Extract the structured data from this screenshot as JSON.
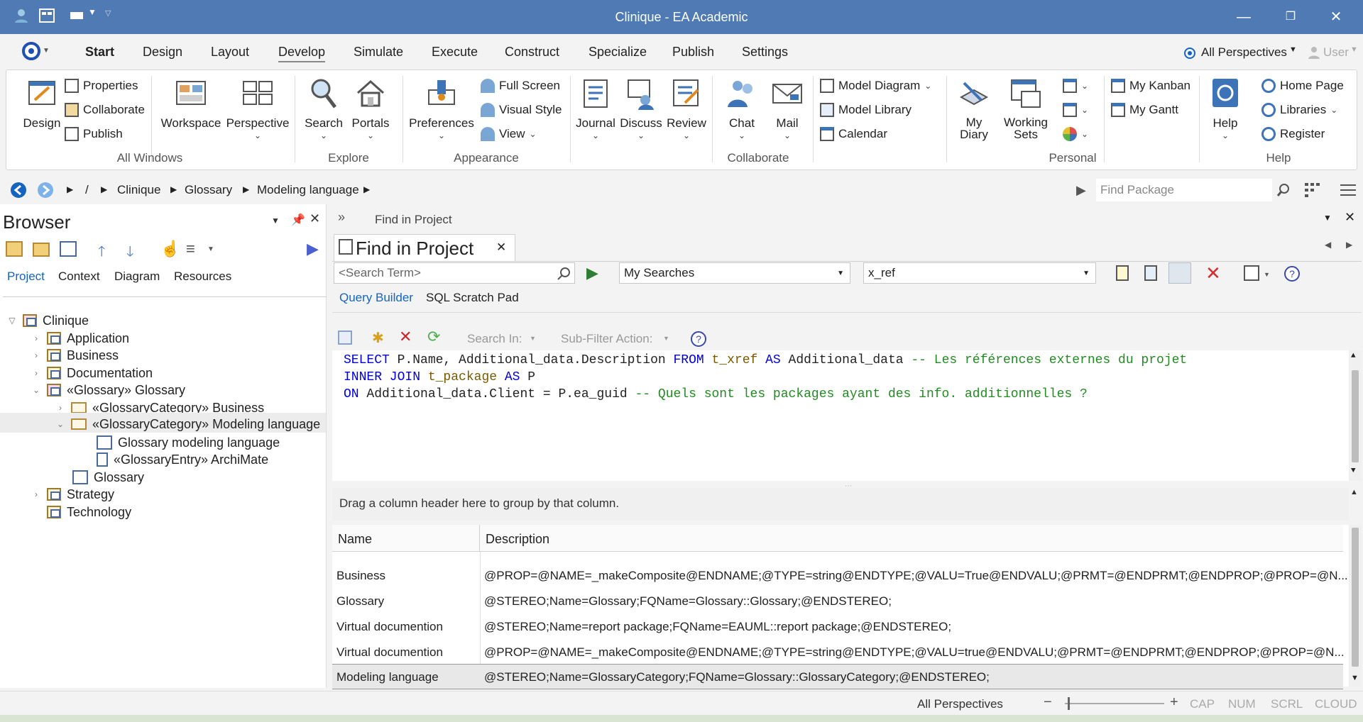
{
  "app": {
    "title": "Clinique - EA Academic"
  },
  "ribbon_tabs": [
    "Start",
    "Design",
    "Layout",
    "Develop",
    "Simulate",
    "Execute",
    "Construct",
    "Specialize",
    "Publish",
    "Settings"
  ],
  "perspectives_label": "All Perspectives",
  "user_label": "User",
  "groups": {
    "all_windows": {
      "label": "All Windows",
      "design": "Design",
      "properties": "Properties",
      "collaborate": "Collaborate",
      "publish": "Publish",
      "workspace": "Workspace",
      "perspective": "Perspective"
    },
    "explore": {
      "label": "Explore",
      "search": "Search",
      "portals": "Portals"
    },
    "appearance": {
      "label": "Appearance",
      "preferences": "Preferences",
      "full_screen": "Full Screen",
      "visual_style": "Visual Style",
      "view": "View"
    },
    "collaborate": {
      "label": "Collaborate",
      "journal": "Journal",
      "discuss": "Discuss",
      "review": "Review",
      "chat": "Chat",
      "mail": "Mail",
      "model_diagram": "Model Diagram",
      "model_library": "Model Library",
      "calendar": "Calendar"
    },
    "personal": {
      "label": "Personal",
      "my_diary_1": "My",
      "my_diary_2": "Diary",
      "working_sets_1": "Working",
      "working_sets_2": "Sets",
      "my_kanban": "My Kanban",
      "my_gantt": "My Gantt"
    },
    "help": {
      "label": "Help",
      "help": "Help",
      "home_page": "Home Page",
      "libraries": "Libraries",
      "register": "Register"
    }
  },
  "breadcrumb": {
    "root": "/",
    "items": [
      "Clinique",
      "Glossary",
      "Modeling language"
    ]
  },
  "find_package_placeholder": "Find Package",
  "browser": {
    "title": "Browser",
    "tabs": [
      "Project",
      "Context",
      "Diagram",
      "Resources"
    ],
    "tree": [
      "Clinique",
      "Application",
      "Business",
      "Documentation",
      "«Glossary» Glossary",
      "«GlossaryCategory» Business",
      "«GlossaryCategory» Modeling language",
      "Glossary modeling language",
      "«GlossaryEntry» ArchiMate",
      "Glossary",
      "Strategy",
      "Technology"
    ]
  },
  "find": {
    "header": "Find in Project",
    "tab_title": "Find in Project",
    "search_placeholder": "<Search Term>",
    "my_searches": "My Searches",
    "search_name": "x_ref",
    "subtabs": [
      "Query Builder",
      "SQL Scratch Pad"
    ],
    "search_in": "Search In:",
    "subfilter": "Sub-Filter Action:",
    "sql": {
      "l1_kw1": "SELECT",
      "l1_a": " P.Name, Additional_data.Description ",
      "l1_kw2": "FROM",
      "l1_tb": " t_xref ",
      "l1_kw3": "AS",
      "l1_b": " Additional_data ",
      "l1_cm": "-- Les références externes du projet",
      "l2_kw1": "INNER JOIN",
      "l2_tb": " t_package ",
      "l2_kw2": "AS",
      "l2_a": " P",
      "l3_kw1": "ON",
      "l3_a": " Additional_data.Client = P.ea_guid ",
      "l3_cm": "-- Quels sont les packages ayant des info. additionnelles ?"
    },
    "group_hint": "Drag a column header here to group by that column.",
    "columns": [
      "Name",
      "Description"
    ],
    "rows": [
      {
        "name": "Business",
        "desc": "@PROP=@NAME=_makeComposite@ENDNAME;@TYPE=string@ENDTYPE;@VALU=True@ENDVALU;@PRMT=@ENDPRMT;@ENDPROP;@PROP=@N..."
      },
      {
        "name": "Glossary",
        "desc": "@STEREO;Name=Glossary;FQName=Glossary::Glossary;@ENDSTEREO;"
      },
      {
        "name": "Virtual documention",
        "desc": "@STEREO;Name=report package;FQName=EAUML::report package;@ENDSTEREO;"
      },
      {
        "name": "Virtual documention",
        "desc": "@PROP=@NAME=_makeComposite@ENDNAME;@TYPE=string@ENDTYPE;@VALU=true@ENDVALU;@PRMT=@ENDPRMT;@ENDPROP;@PROP=@N..."
      },
      {
        "name": "Modeling language",
        "desc": "@STEREO;Name=GlossaryCategory;FQName=Glossary::GlossaryCategory;@ENDSTEREO;"
      }
    ]
  },
  "status": {
    "perspectives": "All Perspectives",
    "minus": "−",
    "plus": "+",
    "cap": "CAP",
    "num": "NUM",
    "scrl": "SCRL",
    "cloud": "CLOUD"
  },
  "colors": {
    "title_bar": "#4f7ab3",
    "accent": "#1565c0",
    "sql_keyword": "#0000e0",
    "sql_comment": "#228b22"
  }
}
